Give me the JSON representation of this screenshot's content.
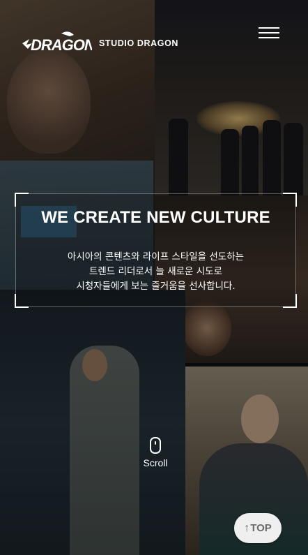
{
  "header": {
    "brand_text": "STUDIO DRAGON",
    "logo_icon": "dragon-logo-icon",
    "menu_icon": "hamburger-menu-icon"
  },
  "hero": {
    "title": "WE CREATE NEW CULTURE",
    "description_lines": [
      "아시아의 콘텐츠와 라이프 스타일을 선도하는",
      "트렌드 리더로서 늘 새로운 시도로",
      "시청자들에게 보는 즐거움을 선사합니다."
    ]
  },
  "scroll": {
    "label": "Scroll",
    "icon": "mouse-scroll-icon"
  },
  "top_button": {
    "arrow": "↑",
    "label": "TOP"
  },
  "colors": {
    "text": "#ffffff",
    "top_button_bg": "#efefef",
    "top_button_text": "#6a6a6a"
  }
}
